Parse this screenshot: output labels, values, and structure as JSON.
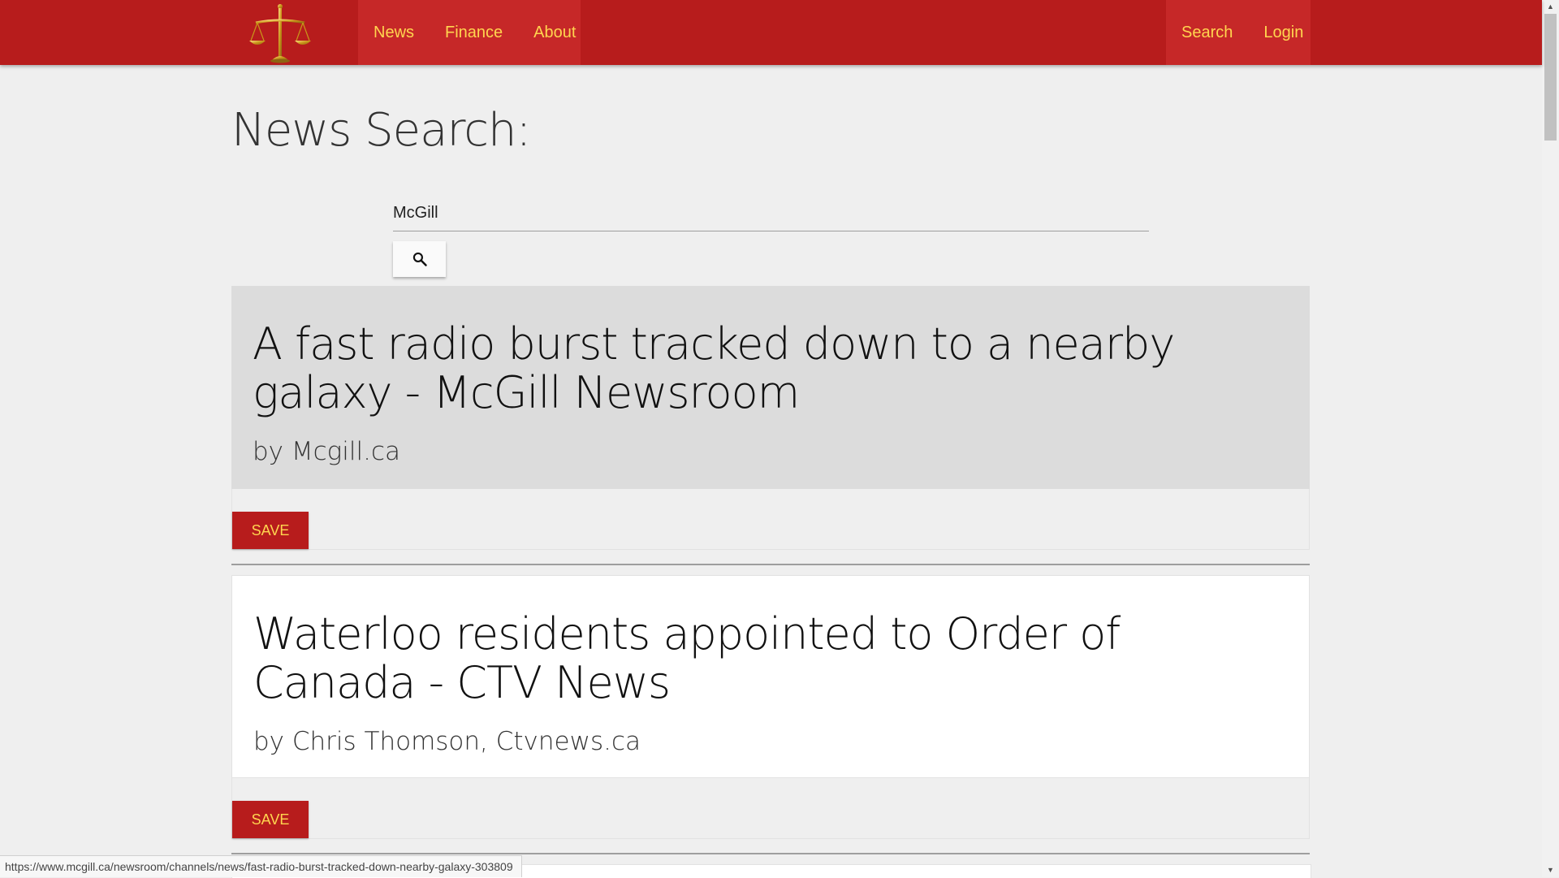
{
  "nav": {
    "left_items": [
      "News",
      "Finance",
      "About"
    ],
    "right_items": [
      "Search",
      "Login"
    ]
  },
  "page": {
    "title": "News Search:"
  },
  "search": {
    "value": "McGill",
    "button_icon": "search-icon"
  },
  "results": [
    {
      "title": "A fast radio burst tracked down to a nearby galaxy - McGill Newsroom",
      "author": "by Mcgill.ca",
      "save_label": "SAVE",
      "highlighted": true
    },
    {
      "title": "Waterloo residents appointed to Order of Canada - CTV News",
      "author": "by Chris Thomson, Ctvnews.ca",
      "save_label": "SAVE",
      "highlighted": false
    }
  ],
  "status_bar": {
    "url": "https://www.mcgill.ca/newsroom/channels/news/fast-radio-burst-tracked-down-nearby-galaxy-303809"
  },
  "colors": {
    "brand_red": "#b71c1c",
    "nav_highlight": "#c62828",
    "accent_yellow": "#ffd54f",
    "highlight_card": "#dcdcdc",
    "page_bg": "#efefef"
  }
}
